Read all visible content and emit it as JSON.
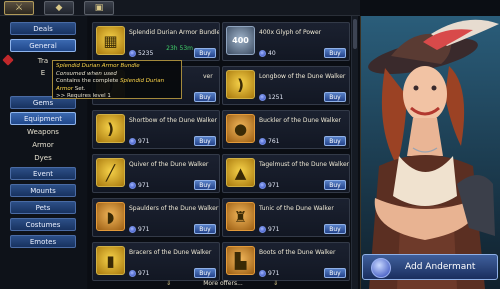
{
  "top_tabs": [
    {
      "icon": "swords-icon"
    },
    {
      "icon": "coin-bag-icon"
    },
    {
      "icon": "chest-icon"
    }
  ],
  "sidebar": {
    "items": [
      {
        "label": "Deals"
      },
      {
        "label": "General"
      },
      {
        "label": "Tra"
      },
      {
        "label": "E"
      },
      {
        "label": "Gems"
      },
      {
        "label": "Equipment"
      },
      {
        "label": "Weapons"
      },
      {
        "label": "Armor"
      },
      {
        "label": "Dyes"
      },
      {
        "label": "Event"
      },
      {
        "label": "Mounts"
      },
      {
        "label": "Pets"
      },
      {
        "label": "Costumes"
      },
      {
        "label": "Emotes"
      }
    ]
  },
  "items": [
    {
      "name": "Splendid Durian Armor Bundle",
      "price": "5235",
      "timer": "23h 53m",
      "buy": "Buy",
      "icon": "bundle-icon",
      "style": "gold"
    },
    {
      "name": "400x Glyph of Power",
      "price": "40",
      "buy": "Buy",
      "icon": "glyph-icon",
      "style": "blue",
      "badge": "400"
    },
    {
      "name": "ver",
      "price": "",
      "buy": "Buy",
      "icon": "bow-icon",
      "style": "gold"
    },
    {
      "name": "Longbow of the Dune Walker",
      "price": "1251",
      "buy": "Buy",
      "icon": "longbow-icon",
      "style": "gold"
    },
    {
      "name": "Shortbow of the Dune Walker",
      "price": "971",
      "buy": "Buy",
      "icon": "shortbow-icon",
      "style": "gold"
    },
    {
      "name": "Buckler of the Dune Walker",
      "price": "761",
      "buy": "Buy",
      "icon": "buckler-icon",
      "style": "orange"
    },
    {
      "name": "Quiver of the Dune Walker",
      "price": "971",
      "buy": "Buy",
      "icon": "quiver-icon",
      "style": "gold"
    },
    {
      "name": "Tagelmust of the Dune Walker",
      "price": "971",
      "buy": "Buy",
      "icon": "helmet-icon",
      "style": "gold"
    },
    {
      "name": "Spaulders of the Dune Walker",
      "price": "971",
      "buy": "Buy",
      "icon": "spaulders-icon",
      "style": "orange"
    },
    {
      "name": "Tunic of the Dune Walker",
      "price": "971",
      "buy": "Buy",
      "icon": "tunic-icon",
      "style": "orange"
    },
    {
      "name": "Bracers of the Dune Walker",
      "price": "971",
      "buy": "Buy",
      "icon": "bracers-icon",
      "style": "gold"
    },
    {
      "name": "Boots of the Dune Walker",
      "price": "971",
      "buy": "Buy",
      "icon": "boots-icon",
      "style": "orange"
    }
  ],
  "more": {
    "label": "More offers..."
  },
  "tooltip": {
    "title": "Splendid Durian Armor Bundle",
    "subtitle": "Consumed when used",
    "desc_prefix": "Contains the complete ",
    "desc_set": "Splendid Durian Armor",
    "desc_suffix": " Set.",
    "req": ">> Requires level 1"
  },
  "add_button": {
    "label": "Add Andermant"
  },
  "colors": {
    "accent": "#2c4f87",
    "gold": "#d0b044",
    "timer": "#41d36b"
  }
}
